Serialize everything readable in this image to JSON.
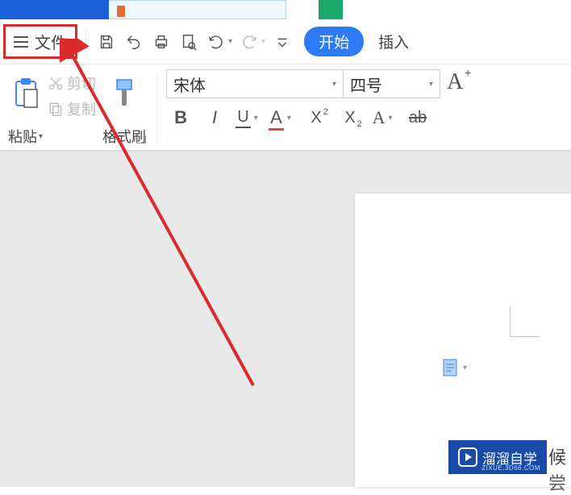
{
  "menu": {
    "file_label": "文件",
    "start_label": "开始",
    "insert_label": "插入"
  },
  "clipboard": {
    "paste_label": "粘贴",
    "cut_label": "剪切",
    "copy_label": "复制",
    "format_painter_label": "格式刷"
  },
  "font": {
    "name": "宋体",
    "size": "四号"
  },
  "document": {
    "visible_text_1": "候",
    "visible_text_2": "尝"
  },
  "watermark": {
    "brand": "溜溜自学",
    "subtext": "ZIXUE.3D66.COM"
  },
  "icons": {
    "hamburger": "hamburger-icon",
    "save": "save-icon",
    "undo_arrow": "undo-arrow-icon",
    "print": "print-icon",
    "preview": "print-preview-icon",
    "undo": "undo-icon",
    "redo": "redo-icon",
    "more": "more-icon",
    "paste": "paste-icon",
    "cut": "cut-icon",
    "copy": "copy-icon",
    "format_painter": "format-painter-icon",
    "font_grow": "font-grow-icon",
    "bold": "bold-icon",
    "italic": "italic-icon",
    "underline": "underline-icon",
    "font_color": "font-color-icon",
    "superscript": "superscript-icon",
    "subscript": "subscript-icon",
    "text_effect": "text-effect-icon",
    "clear_format": "clear-format-icon"
  }
}
